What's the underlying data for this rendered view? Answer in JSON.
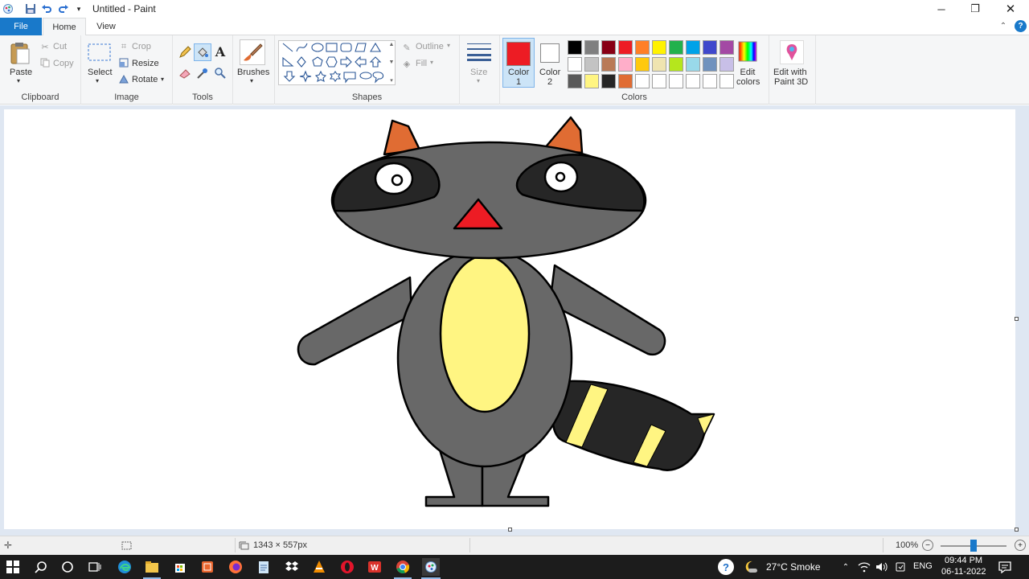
{
  "window": {
    "title": "Untitled - Paint"
  },
  "tabs": {
    "file": "File",
    "home": "Home",
    "view": "View"
  },
  "clipboard": {
    "paste": "Paste",
    "cut": "Cut",
    "copy": "Copy",
    "label": "Clipboard"
  },
  "image": {
    "select": "Select",
    "crop": "Crop",
    "resize": "Resize",
    "rotate": "Rotate",
    "label": "Image"
  },
  "tools": {
    "label": "Tools"
  },
  "brushes": {
    "label": "Brushes"
  },
  "shapes": {
    "outline": "Outline",
    "fill": "Fill",
    "label": "Shapes"
  },
  "size": {
    "label": "Size"
  },
  "colors": {
    "color1": "Color",
    "color1_num": "1",
    "color2": "Color",
    "color2_num": "2",
    "color1_value": "#ed1c24",
    "color2_value": "#ffffff",
    "edit_colors": "Edit colors",
    "label": "Colors",
    "palette_row1": [
      "#000000",
      "#7f7f7f",
      "#880015",
      "#ed1c24",
      "#ff7f27",
      "#fff200",
      "#22b14c",
      "#00a2e8",
      "#3f48cc",
      "#a349a4"
    ],
    "palette_row2": [
      "#ffffff",
      "#c3c3c3",
      "#b97a57",
      "#ffaec9",
      "#ffc90e",
      "#efe4b0",
      "#b5e61d",
      "#99d9ea",
      "#7092be",
      "#c8bfe7"
    ],
    "palette_row3": [
      "#595959",
      "#fff582",
      "#262626",
      "#e06c33",
      "#ffffff",
      "#ffffff",
      "#ffffff",
      "#ffffff",
      "#ffffff",
      "#ffffff"
    ]
  },
  "paint3d": {
    "label1": "Edit with",
    "label2": "Paint 3D"
  },
  "status": {
    "dimensions": "1343 × 557px",
    "zoom": "100%"
  },
  "taskbar": {
    "weather": "27°C  Smoke",
    "language": "ENG",
    "time": "09:44 PM",
    "date": "06-11-2022"
  }
}
